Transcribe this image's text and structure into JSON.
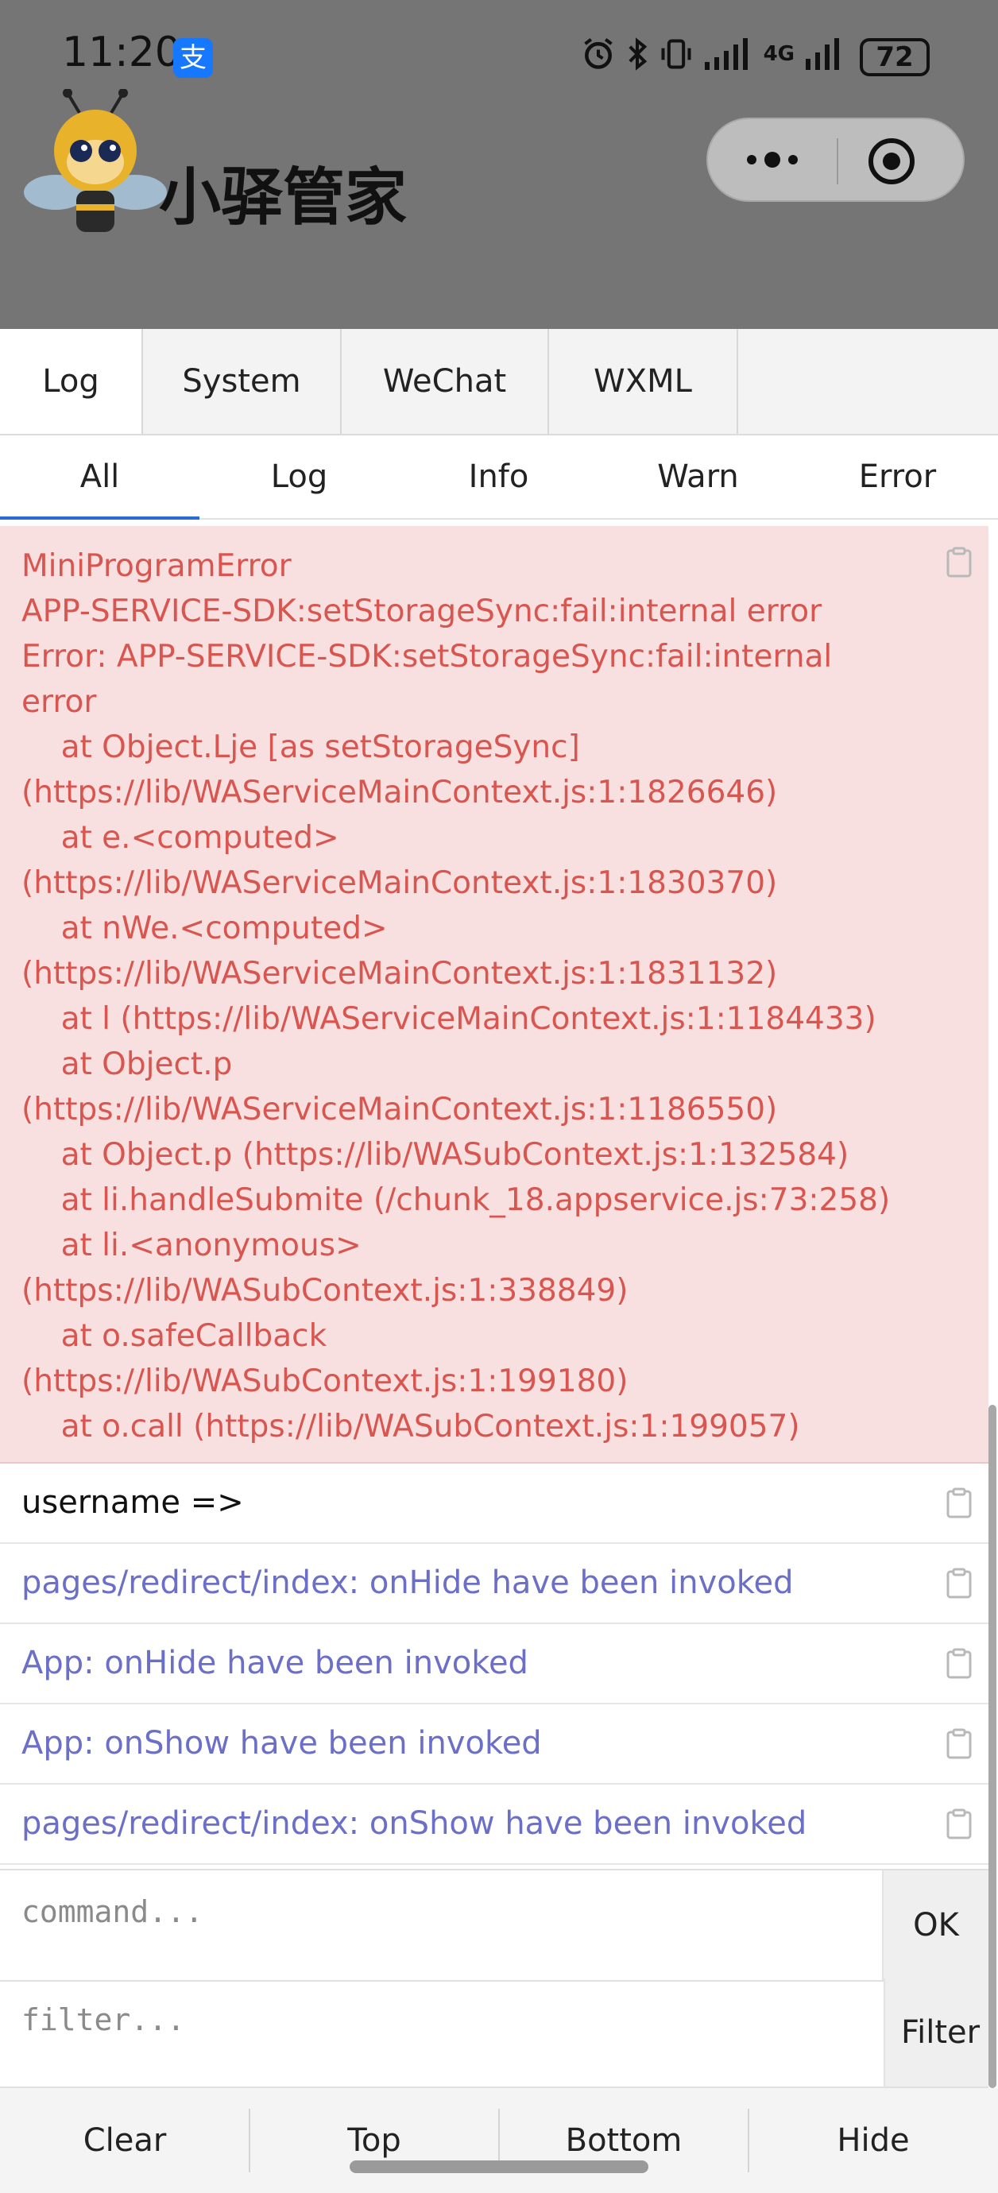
{
  "status_bar": {
    "time": "11:20",
    "alipay_badge": "支",
    "network": "4G",
    "battery": "72"
  },
  "app_header": {
    "title": "小驿管家"
  },
  "capsule": {
    "more_icon": "more-dots-icon",
    "close_icon": "target-circle-icon"
  },
  "vconsole": {
    "tabs": [
      "Log",
      "System",
      "WeChat",
      "WXML"
    ],
    "active_tab": "Log",
    "subtabs": [
      "All",
      "Log",
      "Info",
      "Warn",
      "Error"
    ],
    "active_subtab": "All",
    "entries": [
      {
        "level": "error",
        "lines": [
          "MiniProgramError",
          "APP-SERVICE-SDK:setStorageSync:fail:internal error",
          "Error: APP-SERVICE-SDK:setStorageSync:fail:internal",
          "error",
          "    at Object.Lje [as setStorageSync]",
          "(https://lib/WAServiceMainContext.js:1:1826646)",
          "    at e.<computed>",
          "(https://lib/WAServiceMainContext.js:1:1830370)",
          "    at nWe.<computed>",
          "(https://lib/WAServiceMainContext.js:1:1831132)",
          "    at l (https://lib/WAServiceMainContext.js:1:1184433)",
          "    at Object.p",
          "(https://lib/WAServiceMainContext.js:1:1186550)",
          "    at Object.p (https://lib/WASubContext.js:1:132584)",
          "    at li.handleSubmite (/chunk_18.appservice.js:73:258)",
          "    at li.<anonymous>",
          "(https://lib/WASubContext.js:1:338849)",
          "    at o.safeCallback",
          "(https://lib/WASubContext.js:1:199180)",
          "    at o.call (https://lib/WASubContext.js:1:199057)"
        ]
      },
      {
        "level": "log",
        "text": "username =>"
      },
      {
        "level": "info",
        "text": "pages/redirect/index: onHide have been invoked"
      },
      {
        "level": "info",
        "text": "App: onHide have been invoked"
      },
      {
        "level": "info",
        "text": "App: onShow have been invoked"
      },
      {
        "level": "info",
        "text": "pages/redirect/index: onShow have been invoked"
      }
    ],
    "command": {
      "placeholder": "command...",
      "button": "OK"
    },
    "filter": {
      "placeholder": "filter...",
      "button": "Filter"
    },
    "toolbar": [
      "Clear",
      "Top",
      "Bottom",
      "Hide"
    ]
  },
  "colors": {
    "error_bg": "#f9e0e0",
    "error_text": "#d8564f",
    "info_text": "#6b6fc7",
    "active_underline": "#2a6bd3",
    "header_bg": "#757575"
  }
}
